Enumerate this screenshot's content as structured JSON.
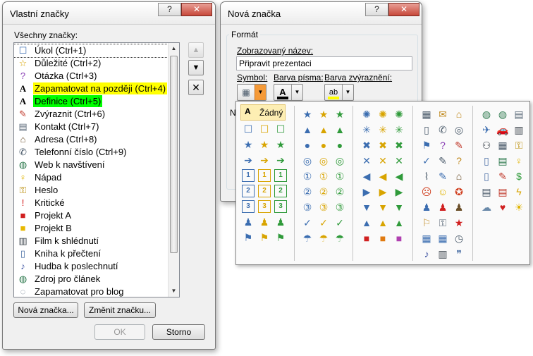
{
  "left_dialog": {
    "title": "Vlastní značky",
    "help_label": "?",
    "close_label": "✕",
    "list_label": "Všechny značky:",
    "items": [
      {
        "label": "Úkol (Ctrl+1)",
        "icon": "checkbox-icon",
        "glyph": "☐",
        "color": "#3b6db0"
      },
      {
        "label": "Důležité (Ctrl+2)",
        "icon": "star-icon",
        "glyph": "☆",
        "color": "#d8a400"
      },
      {
        "label": "Otázka (Ctrl+3)",
        "icon": "question-icon",
        "glyph": "?",
        "color": "#8a3fb5"
      },
      {
        "label": "Zapamatovat na později (Ctrl+4)",
        "icon": "highlight-icon",
        "glyph": "A",
        "color": "#000000",
        "highlight": "yellow"
      },
      {
        "label": "Definice (Ctrl+5)",
        "icon": "highlight-icon",
        "glyph": "A",
        "color": "#000000",
        "highlight": "green"
      },
      {
        "label": "Zvýraznit (Ctrl+6)",
        "icon": "pen-icon",
        "glyph": "✎",
        "color": "#c0392b"
      },
      {
        "label": "Kontakt (Ctrl+7)",
        "icon": "contact-card-icon",
        "glyph": "▤",
        "color": "#5c6b7a"
      },
      {
        "label": "Adresa (Ctrl+8)",
        "icon": "house-icon",
        "glyph": "⌂",
        "color": "#6b4f2a"
      },
      {
        "label": "Telefonní číslo (Ctrl+9)",
        "icon": "phone-icon",
        "glyph": "✆",
        "color": "#4a5a6a"
      },
      {
        "label": "Web k navštívení",
        "icon": "globe-link-icon",
        "glyph": "◍",
        "color": "#2f7a4f"
      },
      {
        "label": "Nápad",
        "icon": "lightbulb-icon",
        "glyph": "♀",
        "color": "#e0b400"
      },
      {
        "label": "Heslo",
        "icon": "key-icon",
        "glyph": "⚿",
        "color": "#b88a00"
      },
      {
        "label": "Kritické",
        "icon": "exclamation-icon",
        "glyph": "!",
        "color": "#d01010"
      },
      {
        "label": "Projekt A",
        "icon": "red-square-icon",
        "glyph": "■",
        "color": "#d02020"
      },
      {
        "label": "Projekt B",
        "icon": "yellow-square-icon",
        "glyph": "■",
        "color": "#e8b800"
      },
      {
        "label": "Film k shlédnutí",
        "icon": "film-icon",
        "glyph": "▥",
        "color": "#404850"
      },
      {
        "label": "Kniha k přečtení",
        "icon": "book-icon",
        "glyph": "▯",
        "color": "#4a6fa5"
      },
      {
        "label": "Hudba k poslechnutí",
        "icon": "music-note-icon",
        "glyph": "♪",
        "color": "#3a4fa0"
      },
      {
        "label": "Zdroj pro článek",
        "icon": "source-link-icon",
        "glyph": "◍",
        "color": "#2f7a4f"
      },
      {
        "label": "Zapamatovat pro blog",
        "icon": "speech-bubble-icon",
        "glyph": "◌",
        "color": "#6a7a8a"
      }
    ],
    "new_button": "Nová značka...",
    "change_button": "Změnit značku...",
    "ok_button": "OK",
    "cancel_button": "Storno",
    "move_up_glyph": "▲",
    "move_down_glyph": "▼",
    "delete_glyph": "✕"
  },
  "right_dialog": {
    "title": "Nová značka",
    "help_label": "?",
    "close_label": "✕",
    "group_label": "Formát",
    "name_label": "Zobrazovaný název:",
    "name_value": "Připravit prezentaci",
    "symbol_label": "Symbol:",
    "font_color_label": "Barva písma:",
    "highlight_label": "Barva zvýraznění:",
    "partial_label": "Na",
    "font_color_bar": "#000000",
    "highlight_bar": "#ffff00"
  },
  "palette": {
    "none_label": "Žádný",
    "columns": [
      {
        "name": "checkbox-column",
        "cells": [
          [
            {
              "g": "☐",
              "c": "#3b6db0"
            },
            {
              "g": "☐",
              "c": "#d8a400"
            },
            {
              "g": "☐",
              "c": "#2f9a3a"
            }
          ],
          [
            {
              "g": "★",
              "c": "#3b6db0"
            },
            {
              "g": "★",
              "c": "#d8a400"
            },
            {
              "g": "★",
              "c": "#2f9a3a"
            }
          ],
          [
            {
              "g": "➔",
              "c": "#3b6db0"
            },
            {
              "g": "➔",
              "c": "#d8a400"
            },
            {
              "g": "➔",
              "c": "#2f9a3a"
            }
          ],
          [
            {
              "g": "1",
              "c": "#3b6db0"
            },
            {
              "g": "1",
              "c": "#d8a400"
            },
            {
              "g": "1",
              "c": "#2f9a3a"
            }
          ],
          [
            {
              "g": "2",
              "c": "#3b6db0"
            },
            {
              "g": "2",
              "c": "#d8a400"
            },
            {
              "g": "2",
              "c": "#2f9a3a"
            }
          ],
          [
            {
              "g": "3",
              "c": "#3b6db0"
            },
            {
              "g": "3",
              "c": "#d8a400"
            },
            {
              "g": "3",
              "c": "#2f9a3a"
            }
          ],
          [
            {
              "g": "♟",
              "c": "#3b6db0"
            },
            {
              "g": "♟",
              "c": "#d8a400"
            },
            {
              "g": "♟",
              "c": "#2f9a3a"
            }
          ],
          [
            {
              "g": "⚑",
              "c": "#3b6db0"
            },
            {
              "g": "⚑",
              "c": "#d8a400"
            },
            {
              "g": "⚑",
              "c": "#2f9a3a"
            }
          ]
        ]
      },
      {
        "name": "shape-column",
        "cells": [
          [
            {
              "g": "★",
              "c": "#3b6db0"
            },
            {
              "g": "★",
              "c": "#d8a400"
            },
            {
              "g": "★",
              "c": "#2f9a3a"
            }
          ],
          [
            {
              "g": "▲",
              "c": "#3b6db0"
            },
            {
              "g": "▲",
              "c": "#d8a400"
            },
            {
              "g": "▲",
              "c": "#2f9a3a"
            }
          ],
          [
            {
              "g": "●",
              "c": "#3b6db0"
            },
            {
              "g": "●",
              "c": "#d8a400"
            },
            {
              "g": "●",
              "c": "#2f9a3a"
            }
          ],
          [
            {
              "g": "◎",
              "c": "#3b6db0"
            },
            {
              "g": "◎",
              "c": "#d8a400"
            },
            {
              "g": "◎",
              "c": "#2f9a3a"
            }
          ],
          [
            {
              "g": "①",
              "c": "#3b6db0"
            },
            {
              "g": "①",
              "c": "#d8a400"
            },
            {
              "g": "①",
              "c": "#2f9a3a"
            }
          ],
          [
            {
              "g": "②",
              "c": "#3b6db0"
            },
            {
              "g": "②",
              "c": "#d8a400"
            },
            {
              "g": "②",
              "c": "#2f9a3a"
            }
          ],
          [
            {
              "g": "③",
              "c": "#3b6db0"
            },
            {
              "g": "③",
              "c": "#d8a400"
            },
            {
              "g": "③",
              "c": "#2f9a3a"
            }
          ],
          [
            {
              "g": "✓",
              "c": "#3b6db0"
            },
            {
              "g": "✓",
              "c": "#d8a400"
            },
            {
              "g": "✓",
              "c": "#2f9a3a"
            }
          ],
          [
            {
              "g": "☂",
              "c": "#3b6db0"
            },
            {
              "g": "☂",
              "c": "#d8a400"
            },
            {
              "g": "☂",
              "c": "#2f9a3a"
            }
          ]
        ]
      },
      {
        "name": "arrow-column",
        "cells": [
          [
            {
              "g": "✺",
              "c": "#3b6db0"
            },
            {
              "g": "✺",
              "c": "#d8a400"
            },
            {
              "g": "✺",
              "c": "#2f9a3a"
            }
          ],
          [
            {
              "g": "✳",
              "c": "#3b6db0"
            },
            {
              "g": "✳",
              "c": "#d8a400"
            },
            {
              "g": "✳",
              "c": "#2f9a3a"
            }
          ],
          [
            {
              "g": "✖",
              "c": "#3b6db0"
            },
            {
              "g": "✖",
              "c": "#d8a400"
            },
            {
              "g": "✖",
              "c": "#2f9a3a"
            }
          ],
          [
            {
              "g": "✕",
              "c": "#3b6db0"
            },
            {
              "g": "✕",
              "c": "#d8a400"
            },
            {
              "g": "✕",
              "c": "#2f9a3a"
            }
          ],
          [
            {
              "g": "◀",
              "c": "#3b6db0"
            },
            {
              "g": "◀",
              "c": "#d8a400"
            },
            {
              "g": "◀",
              "c": "#2f9a3a"
            }
          ],
          [
            {
              "g": "▶",
              "c": "#3b6db0"
            },
            {
              "g": "▶",
              "c": "#d8a400"
            },
            {
              "g": "▶",
              "c": "#2f9a3a"
            }
          ],
          [
            {
              "g": "▼",
              "c": "#3b6db0"
            },
            {
              "g": "▼",
              "c": "#d8a400"
            },
            {
              "g": "▼",
              "c": "#2f9a3a"
            }
          ],
          [
            {
              "g": "▲",
              "c": "#3b6db0"
            },
            {
              "g": "▲",
              "c": "#d8a400"
            },
            {
              "g": "▲",
              "c": "#2f9a3a"
            }
          ],
          [
            {
              "g": "■",
              "c": "#d02020"
            },
            {
              "g": "■",
              "c": "#e07a10"
            },
            {
              "g": "■",
              "c": "#b040b0"
            }
          ]
        ]
      },
      {
        "name": "object-column",
        "cells": [
          [
            {
              "g": "▦",
              "c": "#4a5a6a"
            },
            {
              "g": "✉",
              "c": "#c08a20"
            },
            {
              "g": "⌂",
              "c": "#c08a20"
            }
          ],
          [
            {
              "g": "▯",
              "c": "#4a5a6a"
            },
            {
              "g": "✆",
              "c": "#4a5a6a"
            },
            {
              "g": "◎",
              "c": "#4a5a6a"
            }
          ],
          [
            {
              "g": "⚑",
              "c": "#3b6db0"
            },
            {
              "g": "?",
              "c": "#8a3fb5"
            },
            {
              "g": "✎",
              "c": "#c0392b"
            }
          ],
          [
            {
              "g": "✓",
              "c": "#3b6db0"
            },
            {
              "g": "✎",
              "c": "#4a5a6a"
            },
            {
              "g": "?",
              "c": "#c08a20"
            }
          ],
          [
            {
              "g": "⌇",
              "c": "#4a5a6a"
            },
            {
              "g": "✎",
              "c": "#3b6db0"
            },
            {
              "g": "⌂",
              "c": "#6b4f2a"
            }
          ],
          [
            {
              "g": "☹",
              "c": "#d04020"
            },
            {
              "g": "☺",
              "c": "#e0b400"
            },
            {
              "g": "✪",
              "c": "#d04020"
            }
          ],
          [
            {
              "g": "♟",
              "c": "#3b6db0"
            },
            {
              "g": "♟",
              "c": "#d02020"
            },
            {
              "g": "♟",
              "c": "#6b4f2a"
            }
          ],
          [
            {
              "g": "⚐",
              "c": "#c08a20"
            },
            {
              "g": "⚿",
              "c": "#4a5a6a"
            },
            {
              "g": "★",
              "c": "#d02020"
            }
          ],
          [
            {
              "g": "▦",
              "c": "#3b6db0"
            },
            {
              "g": "▦",
              "c": "#3b6db0"
            },
            {
              "g": "◷",
              "c": "#4a5a6a"
            }
          ],
          [
            {
              "g": "♪",
              "c": "#3a4fa0"
            },
            {
              "g": "▥",
              "c": "#404850"
            },
            {
              "g": "❞",
              "c": "#4a6fa5"
            }
          ]
        ]
      },
      {
        "name": "misc-column",
        "cells": [
          [
            {
              "g": "◍",
              "c": "#2f7a4f"
            },
            {
              "g": "◍",
              "c": "#2f7a4f"
            },
            {
              "g": "▤",
              "c": "#5c6b7a"
            }
          ],
          [
            {
              "g": "✈",
              "c": "#3b6db0"
            },
            {
              "g": "🚗",
              "c": "#d02020"
            },
            {
              "g": "▥",
              "c": "#404850"
            }
          ],
          [
            {
              "g": "⚇",
              "c": "#404850"
            },
            {
              "g": "▦",
              "c": "#4a5a6a"
            },
            {
              "g": "⚿",
              "c": "#b88a00"
            }
          ],
          [
            {
              "g": "▯",
              "c": "#4a6fa5"
            },
            {
              "g": "▤",
              "c": "#2f7a4f"
            },
            {
              "g": "♀",
              "c": "#e0b400"
            }
          ],
          [
            {
              "g": "▯",
              "c": "#4a6fa5"
            },
            {
              "g": "✎",
              "c": "#c0392b"
            },
            {
              "g": "$",
              "c": "#2f9a3a"
            }
          ],
          [
            {
              "g": "▤",
              "c": "#4a5a6a"
            },
            {
              "g": "▤",
              "c": "#c0392b"
            },
            {
              "g": "ϟ",
              "c": "#d8a400"
            }
          ],
          [
            {
              "g": "☁",
              "c": "#6a8aaa"
            },
            {
              "g": "♥",
              "c": "#d02020"
            },
            {
              "g": "☀",
              "c": "#e0b400"
            }
          ]
        ]
      }
    ]
  }
}
